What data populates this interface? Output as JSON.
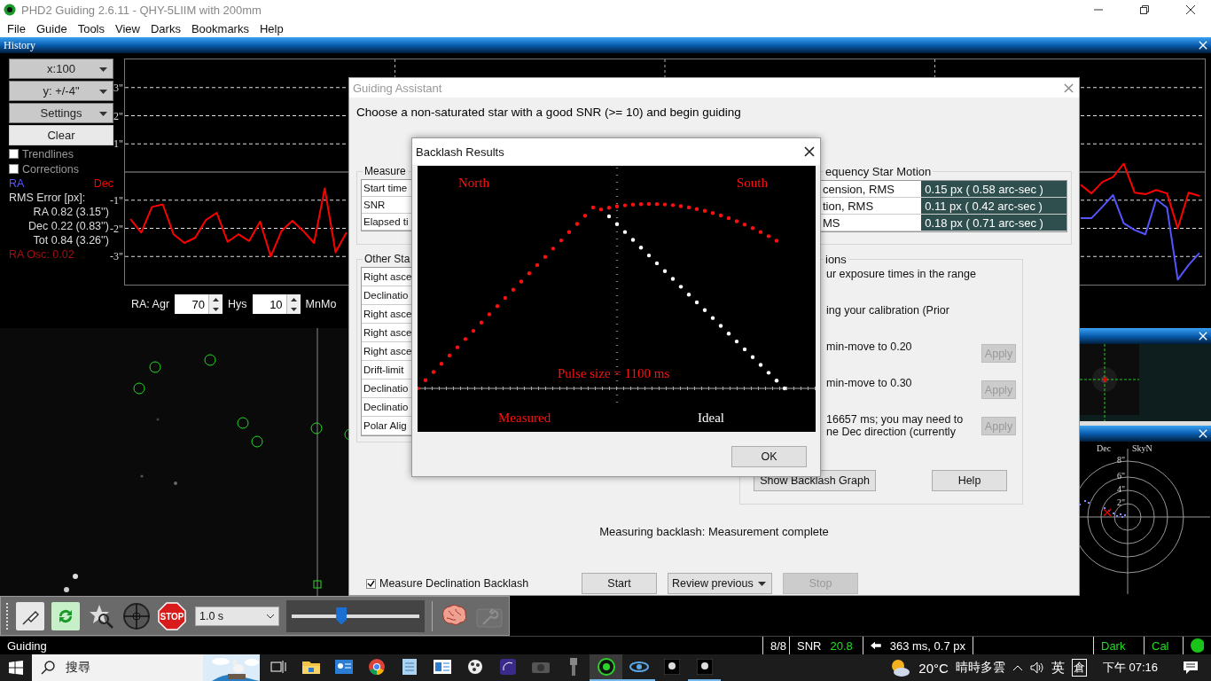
{
  "window": {
    "title": "PHD2 Guiding 2.6.11 - QHY-5LIIM with 200mm"
  },
  "menu": [
    "File",
    "Guide",
    "Tools",
    "View",
    "Darks",
    "Bookmarks",
    "Help"
  ],
  "history": {
    "title": "History",
    "controls": [
      {
        "label": "x:100",
        "kind": "dropdown"
      },
      {
        "label": "y: +/-4\"",
        "kind": "dropdown"
      },
      {
        "label": "Settings",
        "kind": "dropdown"
      },
      {
        "label": "Clear",
        "kind": "button"
      }
    ],
    "options": [
      {
        "label": "Trendlines",
        "checked": false
      },
      {
        "label": "Corrections",
        "checked": false
      }
    ],
    "rms_heading": "RMS Error [px]:",
    "rms": [
      "RA 0.82 (3.15'')",
      "Dec 0.22 (0.83'')",
      "Tot 0.84 (3.26'')"
    ],
    "oscillation": "RA Osc: 0.02",
    "chart_data": {
      "type": "line",
      "categories": [
        null,
        null,
        null,
        null,
        null,
        null,
        null,
        null,
        null,
        null,
        null,
        null,
        null,
        null,
        null,
        null,
        null,
        null,
        null,
        null,
        null,
        null,
        null,
        null,
        null,
        null,
        null,
        null,
        null,
        null,
        null,
        null,
        null,
        null,
        null,
        null,
        null,
        null,
        null,
        null,
        null,
        null,
        null,
        null,
        null,
        null,
        null,
        null,
        null,
        null,
        null,
        null,
        null,
        null,
        null,
        null,
        null,
        null,
        null,
        null,
        null,
        null,
        null,
        null,
        null,
        null,
        null,
        null,
        null,
        null,
        null,
        null,
        null,
        null,
        null,
        null,
        null,
        null,
        null,
        null,
        null,
        null,
        null,
        null,
        null,
        null,
        null,
        null,
        null,
        null,
        null,
        null,
        null,
        null,
        null,
        null,
        null,
        null,
        null,
        null
      ],
      "ylim": [
        -4,
        4
      ],
      "grid": true,
      "yticks": [
        {
          "value": 3,
          "label": "3\""
        },
        {
          "value": 2,
          "label": "2\""
        },
        {
          "value": 1,
          "label": "1\""
        },
        {
          "value": -1,
          "label": "-1\""
        },
        {
          "value": -2,
          "label": "-2\""
        },
        {
          "value": -3,
          "label": "-3\""
        }
      ],
      "series": [
        {
          "name": "RA",
          "color": "#5555ff",
          "values": [
            null,
            null,
            null,
            null,
            null,
            null,
            null,
            null,
            null,
            null,
            null,
            null,
            null,
            null,
            null,
            null,
            null,
            null,
            null,
            null,
            null,
            null,
            null,
            null,
            null,
            null,
            null,
            null,
            null,
            null,
            null,
            null,
            null,
            null,
            null,
            null,
            null,
            null,
            null,
            null,
            null,
            null,
            null,
            null,
            null,
            null,
            null,
            null,
            null,
            null,
            null,
            null,
            null,
            null,
            null,
            null,
            null,
            null,
            null,
            null,
            null,
            null,
            null,
            null,
            null,
            null,
            null,
            null,
            null,
            null,
            null,
            null,
            null,
            null,
            null,
            null,
            null,
            null,
            null,
            null,
            null,
            null,
            null,
            null,
            null,
            null,
            null,
            null,
            -1.64,
            -1.64,
            -1.24,
            -0.82,
            -1.82,
            -2.06,
            -2.21,
            -0.97,
            -1.27,
            -3.82,
            -3.3,
            -2.88
          ]
        },
        {
          "name": "Dec",
          "color": "#ff0000",
          "values": [
            -1.67,
            -2.15,
            -1.24,
            -1.15,
            -2.21,
            -2.52,
            -2.33,
            -1.7,
            -1.45,
            -2.48,
            -2.21,
            -2.45,
            -1.76,
            -3.0,
            -2.09,
            -1.73,
            -2.09,
            -2.52,
            -0.58,
            -2.85,
            -2.15,
            null,
            null,
            null,
            null,
            null,
            null,
            null,
            null,
            null,
            null,
            null,
            null,
            null,
            null,
            null,
            null,
            null,
            null,
            null,
            null,
            null,
            null,
            null,
            null,
            null,
            null,
            null,
            null,
            null,
            null,
            null,
            null,
            null,
            null,
            null,
            null,
            null,
            null,
            null,
            null,
            null,
            null,
            null,
            null,
            null,
            null,
            null,
            null,
            null,
            null,
            null,
            null,
            null,
            null,
            null,
            null,
            null,
            null,
            null,
            null,
            null,
            null,
            null,
            null,
            null,
            null,
            null,
            -0.45,
            -0.76,
            -0.36,
            -0.18,
            0.3,
            -0.73,
            -0.79,
            -0.64,
            -0.76,
            -2.0,
            -0.73,
            -0.85
          ]
        }
      ]
    },
    "params": [
      {
        "label": "RA: Agr",
        "value": "70"
      },
      {
        "label": "Hys",
        "value": "10"
      }
    ],
    "params_tail": "MnMo"
  },
  "guiding_assistant": {
    "title": "Guiding Assistant",
    "instructions": "Choose a non-saturated star with a good SNR (>= 10) and begin guiding",
    "measurement": {
      "title": "Measure",
      "rows": [
        "Start time",
        "SNR",
        "Elapsed ti"
      ]
    },
    "high_frequency": {
      "title": "equency Star Motion",
      "rows": [
        {
          "label": "cension, RMS",
          "value": "0.15 px ( 0.58 arc-sec )"
        },
        {
          "label": "tion, RMS",
          "value": "0.11 px ( 0.42 arc-sec )"
        },
        {
          "label": "MS",
          "value": "0.18 px ( 0.71 arc-sec )"
        }
      ]
    },
    "other_stats": {
      "title": "Other Sta",
      "rows": [
        "Right asce",
        "Declinatio",
        "Right asce",
        "Right asce",
        "Right asce",
        "Drift-limit",
        "Declinatio",
        "Declinatio",
        "Polar Alig"
      ]
    },
    "recommendations": {
      "title": "ions",
      "items": [
        {
          "lines": [
            "ur exposure times in the range"
          ]
        },
        {
          "lines": [
            "ing your calibration (Prior"
          ]
        },
        {
          "lines": [
            "min-move to 0.20"
          ],
          "action": "Apply",
          "disabled": true
        },
        {
          "lines": [
            "min-move to 0.30"
          ],
          "action": "Apply",
          "disabled": true
        },
        {
          "lines": [
            "16657 ms; you may need to",
            "ne Dec direction (currently"
          ],
          "action": "Apply",
          "disabled": true
        }
      ],
      "buttons": [
        "Show Backlash Graph",
        "Help"
      ]
    },
    "status": "Measuring backlash: Measurement complete",
    "measure_backlash": {
      "label": "Measure Declination Backlash",
      "checked": true
    },
    "actions": [
      {
        "label": "Start",
        "kind": "button",
        "disabled": false
      },
      {
        "label": "Review previous",
        "kind": "dropdown",
        "disabled": false
      },
      {
        "label": "Stop",
        "kind": "button",
        "disabled": true
      }
    ]
  },
  "backlash": {
    "title": "Backlash Results",
    "north": "North",
    "south": "South",
    "pulse": "Pulse size = 1100 ms",
    "measured": "Measured",
    "ideal": "Ideal",
    "ok": "OK"
  },
  "target": {
    "dec": "Dec",
    "sky": "SkyN",
    "rings": [
      "8\"",
      "6\"",
      "4\"",
      "2\""
    ]
  },
  "toolbar": {
    "tools": [
      {
        "kind": "connect"
      },
      {
        "kind": "loop"
      },
      {
        "kind": "find_star"
      },
      {
        "kind": "guide"
      },
      {
        "kind": "stop",
        "label": "STOP"
      }
    ],
    "exposure": "1.0 s",
    "slider": {
      "level": 0.39
    },
    "extras": [
      {
        "kind": "brain",
        "disabled": false
      },
      {
        "kind": "settings",
        "disabled": true
      }
    ]
  },
  "status_bar": {
    "message": "Guiding",
    "frames": "8/8",
    "snr_label": "SNR",
    "snr": "20.8",
    "pulse": "363 ms, 0.7 px",
    "dark": "Dark",
    "cal": "Cal"
  },
  "taskbar": {
    "search": "搜尋",
    "apps": [
      {
        "kind": "taskview",
        "running": false
      },
      {
        "kind": "folder",
        "running": false
      },
      {
        "kind": "contacts",
        "running": false
      },
      {
        "kind": "browser",
        "running": false
      },
      {
        "kind": "notepad",
        "running": false
      },
      {
        "kind": "news",
        "running": false
      },
      {
        "kind": "film",
        "running": false
      },
      {
        "kind": "sky",
        "running": false
      },
      {
        "kind": "camera",
        "running": false
      },
      {
        "kind": "mount",
        "running": false
      },
      {
        "kind": "target",
        "running": true
      },
      {
        "kind": "spiral",
        "running": true
      },
      {
        "kind": "capture",
        "running": false
      },
      {
        "kind": "capture",
        "running": true
      }
    ],
    "temperature": "20°C",
    "weather": "晴時多雲",
    "ime": "英",
    "ime_mode": "倉",
    "clock": "下午 07:16"
  }
}
